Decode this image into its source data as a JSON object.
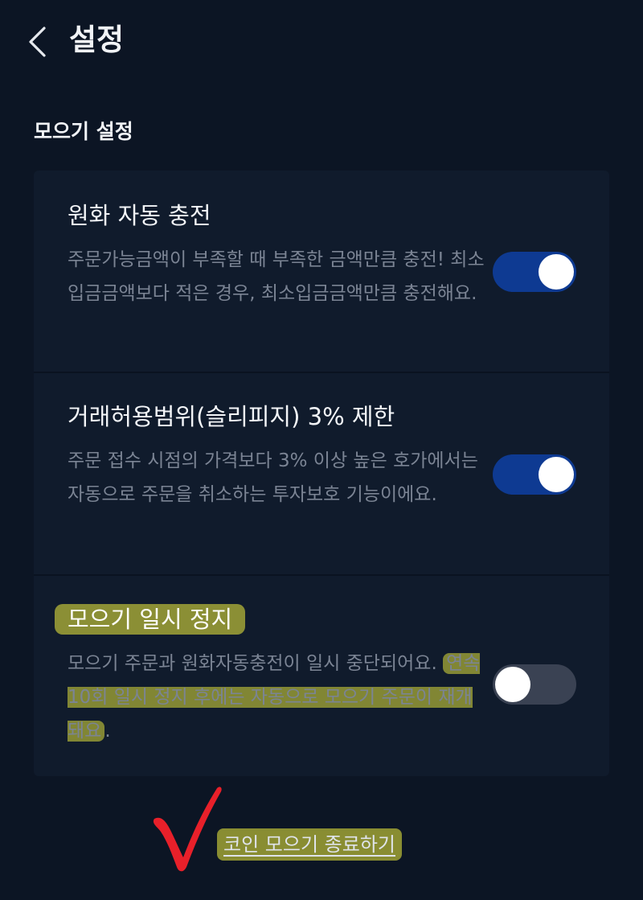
{
  "header": {
    "back_icon": "chevron-left-icon",
    "title": "설정"
  },
  "section": {
    "title": "모으기 설정"
  },
  "settings": [
    {
      "title": "원화 자동 충전",
      "description": "주문가능금액이 부족할 때 부족한 금액만큼 충전! 최소입금금액보다 적은 경우, 최소입금금액만큼 충전해요.",
      "enabled": true
    },
    {
      "title": "거래허용범위(슬리피지) 3% 제한",
      "description": "주문 접수 시점의 가격보다 3% 이상 높은 호가에서는 자동으로 주문을 취소하는 투자보호 기능이에요.",
      "enabled": true
    },
    {
      "title": "모으기 일시 정지",
      "description_part1": "모으기 주문과 원화자동충전이 일시 중단되어요. ",
      "description_part2": "연속 10회 일시 정지 후에는 자동으로 모으기 주문이 재개돼요",
      "description_part3": ".",
      "enabled": false
    }
  ],
  "footer": {
    "end_link": "코인 모으기 종료하기"
  },
  "colors": {
    "background": "#0c1524",
    "card": "#101b2c",
    "toggle_on": "#0e3a92",
    "toggle_off": "#3a4253",
    "highlight": "#dede3c",
    "checkmark": "#e8202a"
  }
}
